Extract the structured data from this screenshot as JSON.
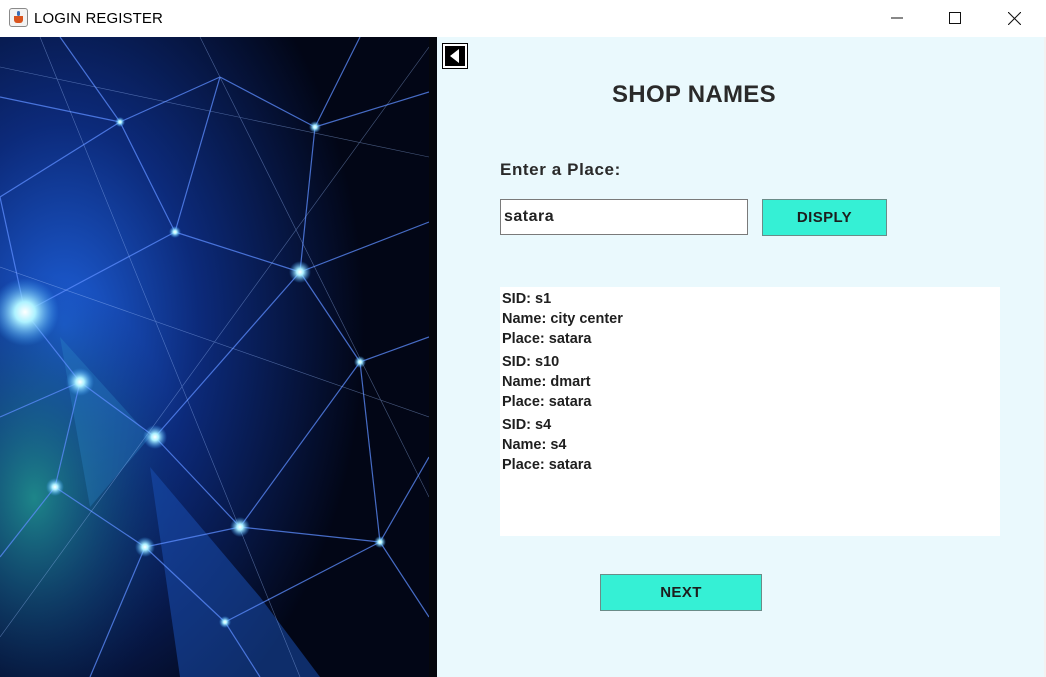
{
  "window": {
    "title": "LOGIN REGISTER"
  },
  "icons": {
    "app": "java-coffee-icon",
    "minimize": "minimize-icon",
    "maximize": "maximize-icon",
    "close": "close-icon",
    "back": "back-arrow-icon"
  },
  "main": {
    "heading": "SHOP NAMES",
    "place_label": "Enter a Place:",
    "place_value": "satara",
    "display_label": "DISPLY",
    "next_label": "NEXT",
    "records": [
      {
        "sid": "SID: s1",
        "name": "Name: city center",
        "place": "Place: satara"
      },
      {
        "sid": "SID: s10",
        "name": "Name: dmart",
        "place": "Place: satara"
      },
      {
        "sid": "SID: s4",
        "name": "Name: s4",
        "place": "Place: satara"
      }
    ]
  },
  "colors": {
    "panel_background": "#eaf9fd",
    "button_accent": "#35f0d5",
    "image_background": "#02061a"
  }
}
